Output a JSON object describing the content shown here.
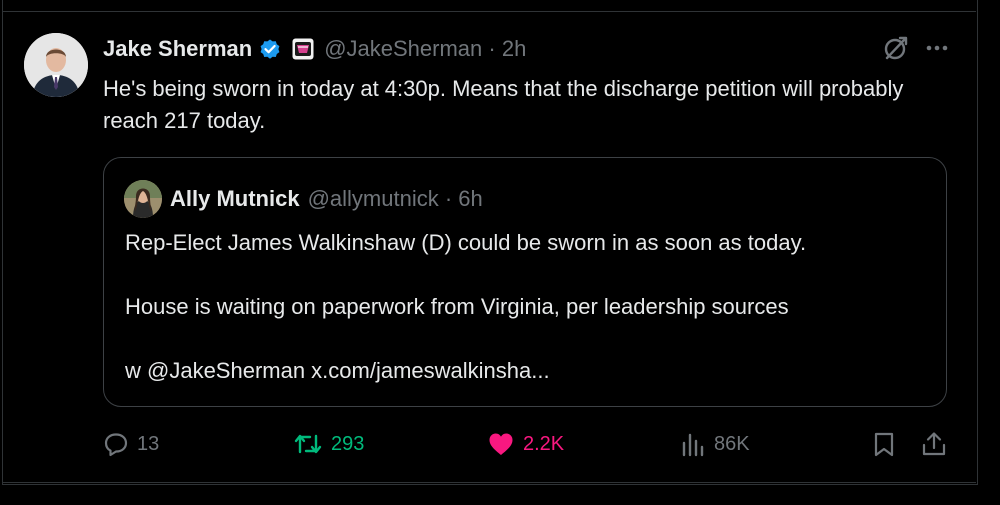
{
  "tweet": {
    "author_name": "Jake Sherman",
    "author_handle": "@JakeSherman",
    "time": "· 2h",
    "text": "He's being sworn in today at 4:30p. Means that the discharge petition will probably reach 217 today."
  },
  "quoted": {
    "author_name": "Ally Mutnick",
    "author_handle": "@allymutnick",
    "time": "· 6h",
    "line1": "Rep-Elect James Walkinshaw (D) could be sworn in as soon as today.",
    "line2": "House is waiting on paperwork from Virginia, per leadership sources",
    "line3": "w @JakeSherman x.com/jameswalkinsha..."
  },
  "metrics": {
    "replies": "13",
    "reposts": "293",
    "likes": "2.2K",
    "views": "86K"
  },
  "colors": {
    "background": "#000000",
    "text": "#e7e9ea",
    "muted": "#71767b",
    "verified": "#1d9bf0",
    "repost": "#00ba7c",
    "like": "#f91880"
  },
  "icons": {
    "verified": "verified-badge-icon",
    "affiliation": "affiliation-badge-icon",
    "grok": "grok-icon",
    "more": "more-icon",
    "reply": "reply-icon",
    "repost": "repost-icon",
    "like": "heart-icon",
    "views": "views-icon",
    "bookmark": "bookmark-icon",
    "share": "share-icon"
  }
}
